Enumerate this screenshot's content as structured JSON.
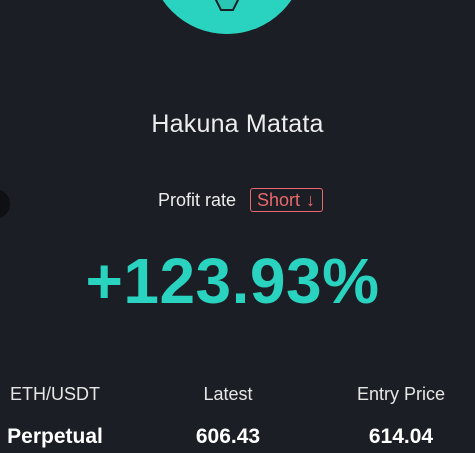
{
  "avatar": {
    "icon": "mascot-icon"
  },
  "profile": {
    "name": "Hakuna Matata"
  },
  "profit": {
    "label": "Profit rate",
    "side": "Short",
    "side_arrow": "↓",
    "value": "+123.93%"
  },
  "details": {
    "pair": {
      "label": "ETH/USDT",
      "value": "Perpetual"
    },
    "latest": {
      "label": "Latest",
      "value": "606.43"
    },
    "entry": {
      "label": "Entry Price",
      "value": "614.04"
    }
  },
  "colors": {
    "background": "#1b1e24",
    "accent": "#2ad3bf",
    "short": "#e8696c"
  }
}
